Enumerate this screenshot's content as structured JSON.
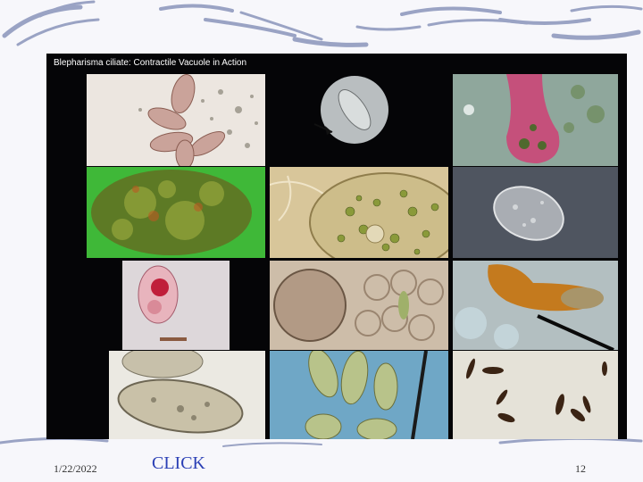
{
  "slide": {
    "title": "Blepharisma ciliate: Contractile Vacuole in Action",
    "date": "1/22/2022",
    "link_label": "CLICK",
    "page_number": "12"
  },
  "colors": {
    "background": "#f7f7fb",
    "panel": "#050507",
    "link": "#2a3fb5",
    "swoosh": "#9aa3c4"
  },
  "images": [
    "blepharisma-cells-brightfield",
    "ciliate-with-arrow-darkfield",
    "pink-ciliate-closeup",
    "green-algae-mass",
    "ciliate-with-green-inclusions",
    "ciliate-dic-grey",
    "pink-ciliate-labeled",
    "round-cyst-plant-cells",
    "orange-ciliate-with-pipette",
    "pale-ciliate-pair",
    "blue-field-ciliates",
    "dark-ciliates-scattered"
  ]
}
